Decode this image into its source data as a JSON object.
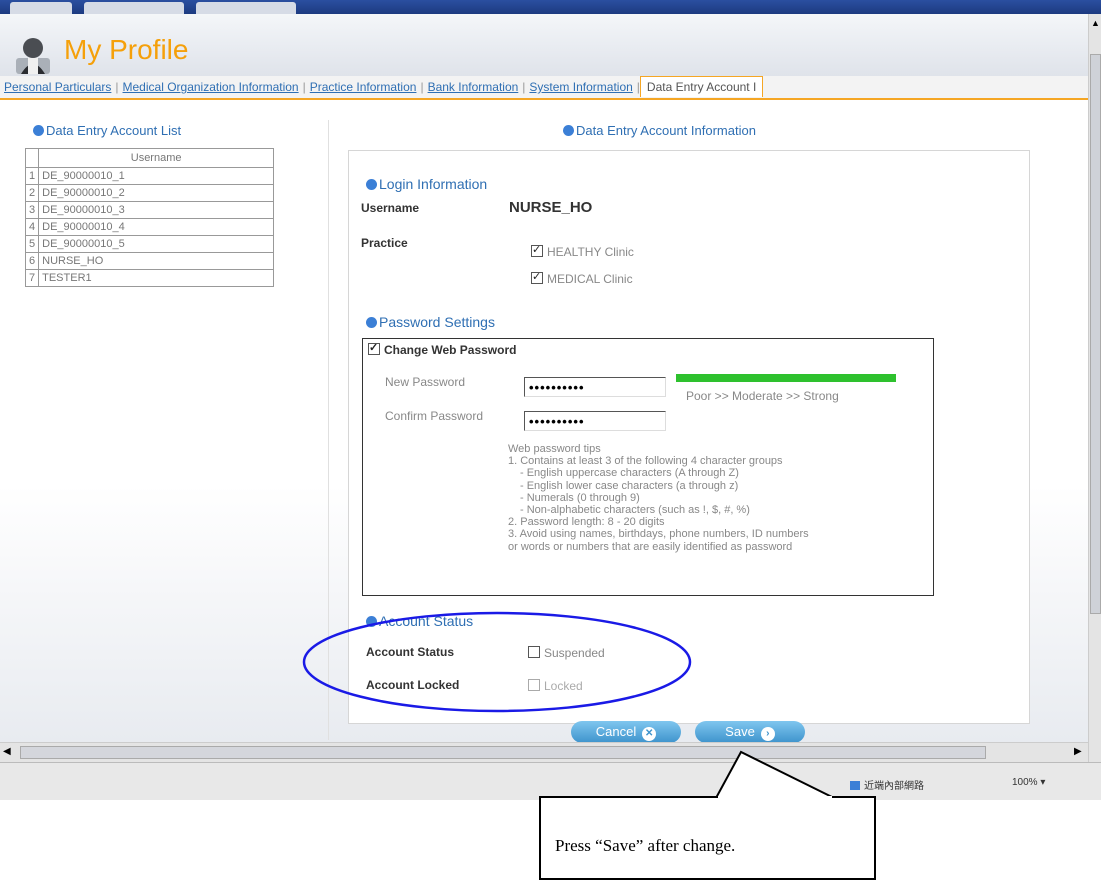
{
  "header": {
    "title": "My Profile"
  },
  "tabs": [
    {
      "label": "Personal Particulars"
    },
    {
      "label": "Medical Organization Information"
    },
    {
      "label": "Practice Information"
    },
    {
      "label": "Bank Information"
    },
    {
      "label": "System Information"
    },
    {
      "label": "Data Entry Account I"
    }
  ],
  "list_panel": {
    "title": "Data Entry Account List",
    "column_header": "Username",
    "rows": [
      {
        "num": "1",
        "username": "DE_90000010_1"
      },
      {
        "num": "2",
        "username": "DE_90000010_2"
      },
      {
        "num": "3",
        "username": "DE_90000010_3"
      },
      {
        "num": "4",
        "username": "DE_90000010_4"
      },
      {
        "num": "5",
        "username": "DE_90000010_5"
      },
      {
        "num": "6",
        "username": "NURSE_HO"
      },
      {
        "num": "7",
        "username": "TESTER1"
      }
    ]
  },
  "info_panel": {
    "title": "Data Entry Account Information",
    "login": {
      "section_title": "Login Information",
      "username_label": "Username",
      "username_value": "NURSE_HO",
      "practice_label": "Practice",
      "practices": [
        {
          "label": "HEALTHY Clinic",
          "checked": true
        },
        {
          "label": "MEDICAL Clinic",
          "checked": true
        }
      ]
    },
    "password": {
      "section_title": "Password Settings",
      "change_label": "Change Web Password",
      "change_checked": true,
      "new_label": "New Password",
      "new_value": "••••••••••",
      "confirm_label": "Confirm Password",
      "confirm_value": "••••••••••",
      "strength_labels": "Poor  >> Moderate >>  Strong",
      "tips": [
        "Web password tips",
        "1. Contains at least 3 of the following 4 character groups",
        "    - English uppercase characters (A through Z)",
        "    - English lower case characters (a through z)",
        "    - Numerals (0 through 9)",
        "    - Non-alphabetic characters (such as !, $, #, %)",
        "2. Password length: 8 - 20 digits",
        "3. Avoid using names, birthdays, phone numbers, ID numbers",
        "or words or numbers that are easily identified as password"
      ]
    },
    "status": {
      "section_title": "Account Status",
      "status_label": "Account Status",
      "suspended_label": "Suspended",
      "suspended_checked": false,
      "locked_label": "Account Locked",
      "locked_option": "Locked",
      "locked_checked": false
    }
  },
  "buttons": {
    "cancel": "Cancel",
    "save": "Save"
  },
  "statusbar": {
    "zone": "近端內部網路",
    "zoom": "100%"
  },
  "callout": {
    "text": "Press “Save” after change."
  },
  "colors": {
    "title_orange": "#f5a00a",
    "link_blue": "#2f6fb3",
    "strength_green": "#2ec12e",
    "highlight_ellipse": "#1a1ae6"
  }
}
